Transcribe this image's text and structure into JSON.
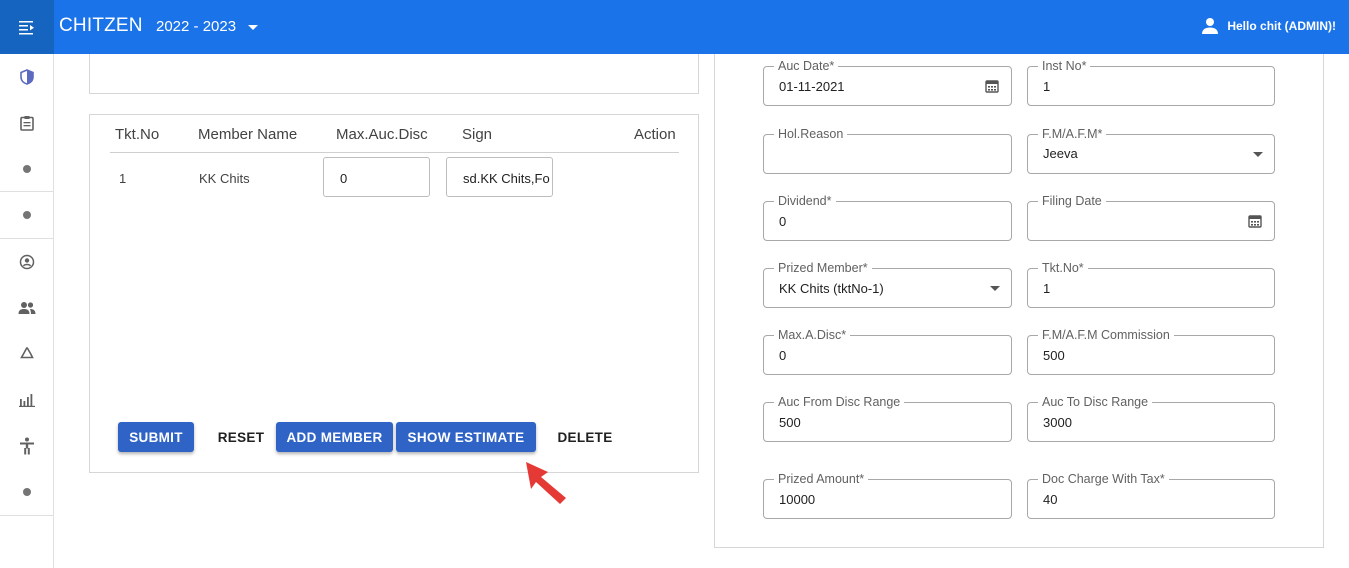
{
  "app": {
    "title": "CHITZEN",
    "year": "2022 - 2023",
    "user": "Hello chit (ADMIN)!"
  },
  "table": {
    "headers": [
      "Tkt.No",
      "Member Name",
      "Max.Auc.Disc",
      "Sign",
      "Action"
    ],
    "rows": [
      {
        "tkt_no": "1",
        "member_name": "KK Chits",
        "max_auc_disc": "0",
        "sign": "sd.KK Chits,Fo"
      }
    ]
  },
  "buttons": {
    "submit": "SUBMIT",
    "reset": "RESET",
    "add_member": "ADD MEMBER",
    "show_estimate": "SHOW ESTIMATE",
    "delete": "DELETE"
  },
  "form": {
    "auc_date": {
      "label": "Auc Date*",
      "value": "01-11-2021"
    },
    "inst_no": {
      "label": "Inst No*",
      "value": "1"
    },
    "hol_reason": {
      "label": "Hol.Reason",
      "value": ""
    },
    "fm_afm": {
      "label": "F.M/A.F.M*",
      "value": "Jeeva"
    },
    "dividend": {
      "label": "Dividend*",
      "value": "0"
    },
    "filing_date": {
      "label": "Filing Date",
      "value": ""
    },
    "prized_member": {
      "label": "Prized Member*",
      "value": "KK Chits (tktNo-1)"
    },
    "tkt_no": {
      "label": "Tkt.No*",
      "value": "1"
    },
    "max_a_disc": {
      "label": "Max.A.Disc*",
      "value": "0"
    },
    "fm_afm_commission": {
      "label": "F.M/A.F.M Commission",
      "value": "500"
    },
    "auc_from_disc_range": {
      "label": "Auc From Disc Range",
      "value": "500"
    },
    "auc_to_disc_range": {
      "label": "Auc To Disc Range",
      "value": "3000"
    },
    "prized_amount": {
      "label": "Prized Amount*",
      "value": "10000"
    },
    "doc_charge_with_tax": {
      "label": "Doc Charge With Tax*",
      "value": "40"
    }
  },
  "colors": {
    "appbar": "#1a73e8",
    "button": "#2f63c6",
    "pointer": "#e53935"
  },
  "icons": {
    "rail": [
      "shield-icon",
      "clipboard-icon",
      "dot-icon",
      "dot-icon",
      "account-circle-icon",
      "group-icon",
      "recycle-icon",
      "bar-chart-icon",
      "accessibility-icon",
      "dot-icon"
    ]
  }
}
